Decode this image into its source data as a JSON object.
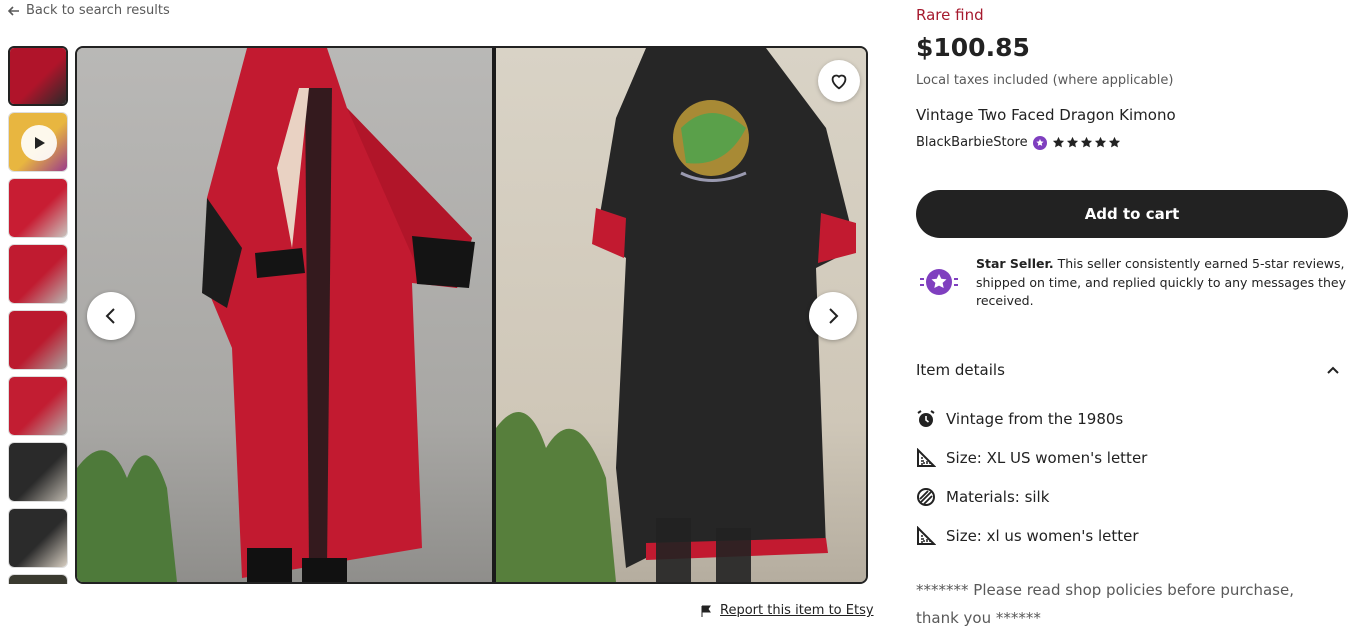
{
  "nav": {
    "back_label": "Back to search results"
  },
  "gallery": {
    "thumbnails": [
      {
        "kind": "image",
        "colors": [
          "#b0142a",
          "#2a2a2a"
        ],
        "selected": true
      },
      {
        "kind": "video",
        "colors": [
          "#e8b640",
          "#9a3b8a"
        ]
      },
      {
        "kind": "image",
        "colors": [
          "#c81d33",
          "#c9c4be"
        ]
      },
      {
        "kind": "image",
        "colors": [
          "#c01b30",
          "#b8b6b2"
        ]
      },
      {
        "kind": "image",
        "colors": [
          "#bb1a2e",
          "#a8a7a3"
        ]
      },
      {
        "kind": "image",
        "colors": [
          "#c21d32",
          "#b4b2ae"
        ]
      },
      {
        "kind": "image",
        "colors": [
          "#2a2a2a",
          "#bdb7ad"
        ]
      },
      {
        "kind": "image",
        "colors": [
          "#2b2b2b",
          "#d8cfc2"
        ]
      },
      {
        "kind": "image",
        "colors": [
          "#3a3a30",
          "#e7d9b8"
        ]
      }
    ],
    "report_label": "Report this item to Etsy"
  },
  "product": {
    "rare_label": "Rare find",
    "price": "$100.85",
    "tax_note": "Local taxes included (where applicable)",
    "title": "Vintage Two Faced Dragon Kimono",
    "shop_name": "BlackBarbieStore",
    "rating": 5,
    "add_to_cart": "Add to cart"
  },
  "star_seller": {
    "heading": "Star Seller.",
    "description": " This seller consistently earned 5-star reviews, shipped on time, and replied quickly to any messages they received."
  },
  "details": {
    "heading": "Item details",
    "items": [
      {
        "icon": "alarm-clock-icon",
        "text": "Vintage from the 1980s"
      },
      {
        "icon": "ruler-icon",
        "text": "Size: XL US women's letter"
      },
      {
        "icon": "materials-icon",
        "text": "Materials: silk"
      },
      {
        "icon": "ruler-icon",
        "text": "Size: xl us women's letter"
      }
    ],
    "policy_note": "******* Please read shop policies before purchase, thank you ******"
  },
  "colors": {
    "accent_rare": "#a61a2e",
    "button_dark": "#222222",
    "star_seller_purple": "#7f3fbf"
  }
}
